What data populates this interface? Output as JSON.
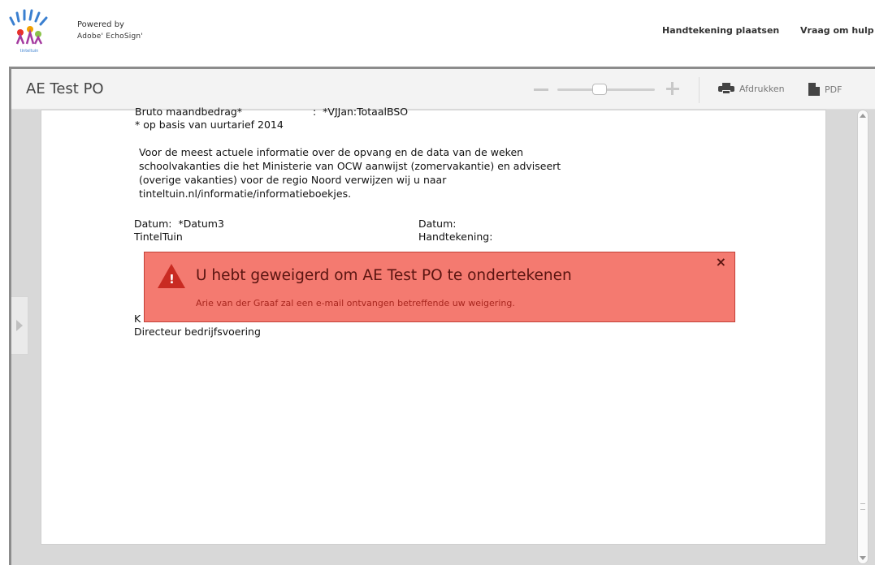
{
  "header": {
    "powered_by_line1": "Powered by",
    "powered_by_line2": "Adobe' EchoSign'",
    "logo_caption": "tinteltuin",
    "links": {
      "sign": "Handtekening plaatsen",
      "help": "Vraag om hulp"
    }
  },
  "viewer": {
    "title": "AE Test PO",
    "print_label": "Afdrukken",
    "pdf_label": "PDF"
  },
  "document": {
    "line1_label": "Bruto maandbedrag*",
    "line1_value": ":  *VJJan:TotaalBSO",
    "line2": "* op basis van uurtarief 2014",
    "para": [
      "Voor de meest actuele informatie over de opvang en de data van de weken",
      "schoolvakanties die het Ministerie van OCW aanwijst (zomervakantie) en adviseert",
      "(overige vakanties) voor de regio Noord verwijzen wij u naar",
      "tinteltuin.nl/informatie/informatieboekjes."
    ],
    "left_date": "Datum:  *Datum3",
    "left_org": "TintelTuin",
    "right_date": "Datum:",
    "right_sign": "Handtekening:",
    "left_name_partial": "K",
    "left_role": "Directeur bedrijfsvoering"
  },
  "alert": {
    "title": "U hebt geweigerd om AE Test PO te ondertekenen",
    "message": "Arie van der Graaf zal een e-mail ontvangen betreffende uw weigering.",
    "close": "×",
    "color": "#f47a70"
  }
}
